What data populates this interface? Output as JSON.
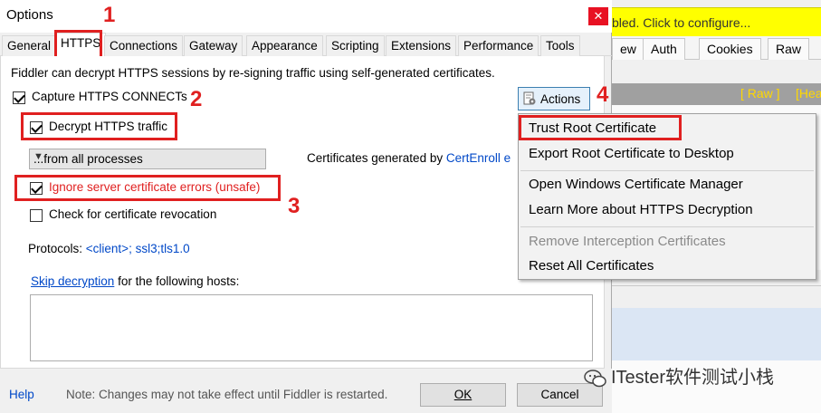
{
  "background_window": {
    "banner_text": "bled. Click to configure...",
    "tabs": [
      "ew",
      "Auth",
      "Cookies",
      "Raw"
    ],
    "raw_bar": [
      "[ Raw ]",
      "[Hea"
    ]
  },
  "dialog": {
    "title": "Options",
    "close_glyph": "✕",
    "tabs": [
      "General",
      "HTTPS",
      "Connections",
      "Gateway",
      "Appearance",
      "Scripting",
      "Extensions",
      "Performance",
      "Tools"
    ],
    "active_tab": "HTTPS"
  },
  "https": {
    "description": "Fiddler can decrypt HTTPS sessions by re-signing traffic using self-generated certificates.",
    "capture_label": "Capture HTTPS CONNECTs",
    "decrypt_label": "Decrypt HTTPS traffic",
    "process_filter": "...from all processes",
    "certs_generated_prefix": "Certificates generated by ",
    "certs_generated_link": "CertEnroll e",
    "ignore_errors_label": "Ignore server certificate errors (unsafe)",
    "revocation_label": "Check for certificate revocation",
    "protocols_label": "Protocols: ",
    "protocols_value": "<client>; ssl3;tls1.0",
    "skip_link": "Skip decryption",
    "skip_rest": " for the following hosts:",
    "capture_checked": true,
    "decrypt_checked": true,
    "ignore_checked": true,
    "revocation_checked": false
  },
  "actions": {
    "button_label": "Actions",
    "menu": [
      {
        "label": "Trust Root Certificate",
        "enabled": true
      },
      {
        "label": "Export Root Certificate to Desktop",
        "enabled": true
      },
      {
        "label": "Open Windows Certificate Manager",
        "enabled": true
      },
      {
        "label": "Learn More about HTTPS Decryption",
        "enabled": true
      },
      {
        "label": "Remove Interception Certificates",
        "enabled": false
      },
      {
        "label": "Reset All Certificates",
        "enabled": true
      }
    ]
  },
  "annotations": [
    "1",
    "2",
    "3",
    "4"
  ],
  "footer": {
    "help": "Help",
    "note": "Note: Changes may not take effect until Fiddler is restarted.",
    "ok": "OK",
    "cancel": "Cancel"
  },
  "watermark": "ITester软件测试小栈",
  "colors": {
    "annotation_red": "#e02020",
    "link_blue": "#0048c8",
    "banner_yellow": "#ffff00",
    "close_red": "#e81123"
  }
}
